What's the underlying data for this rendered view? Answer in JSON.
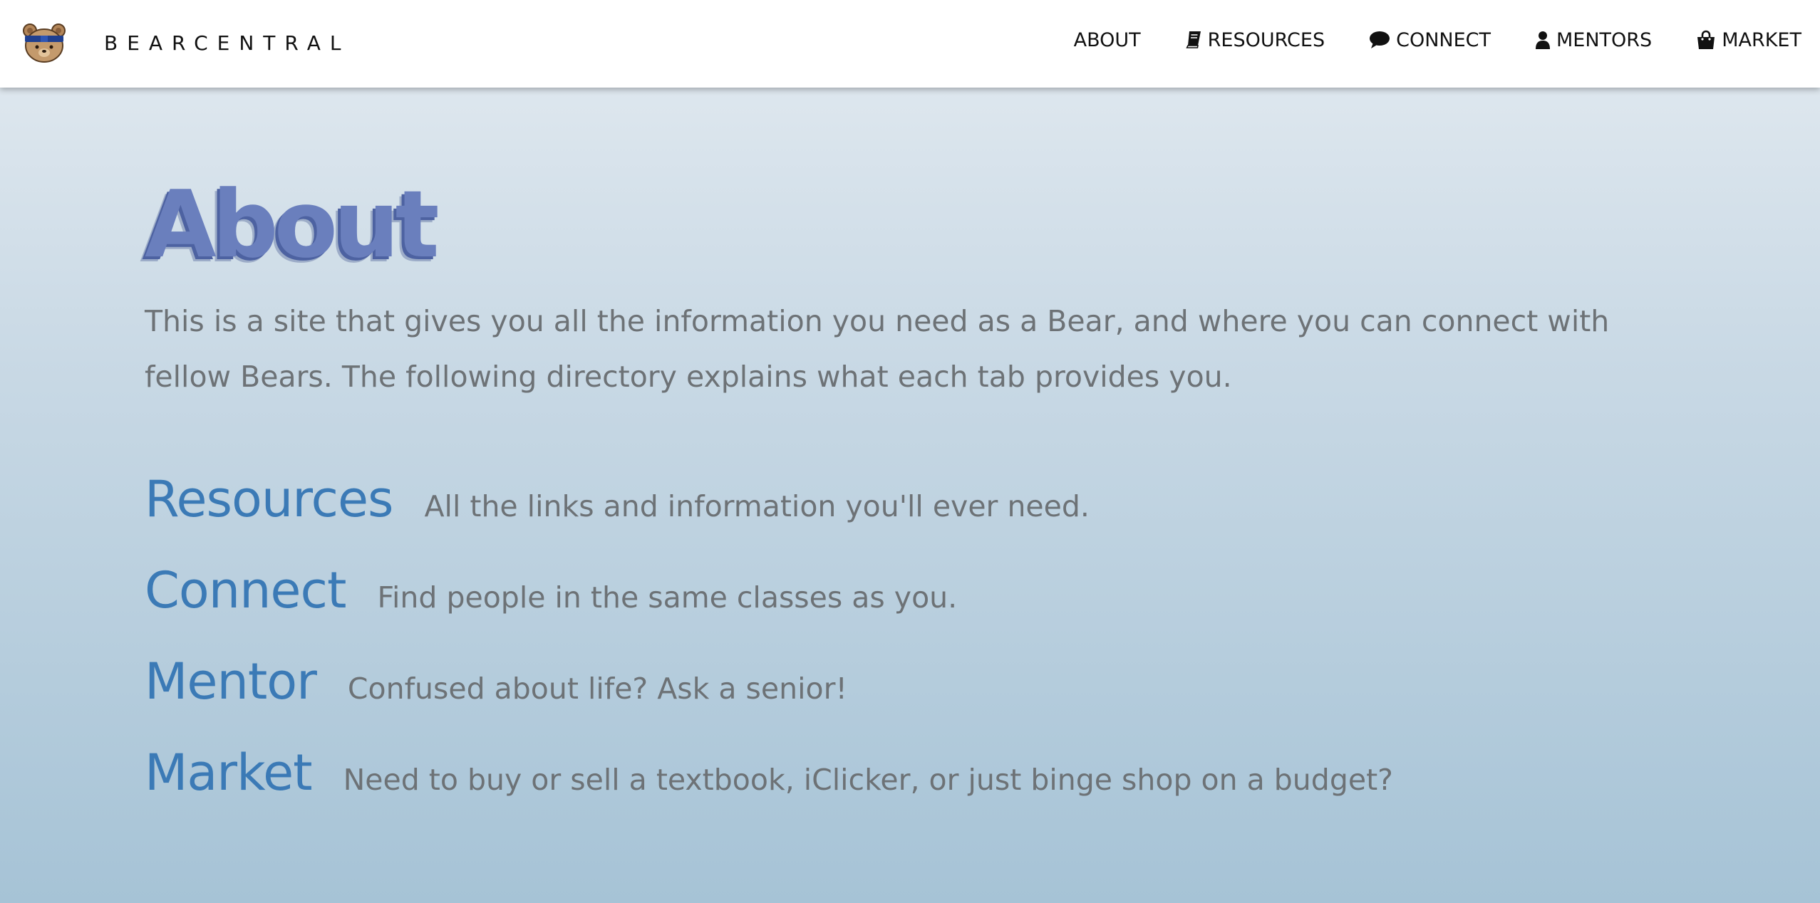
{
  "navbar": {
    "brand": {
      "name": "BEARCENTRAL",
      "logo_icon": "bear-logo-icon"
    },
    "items": [
      {
        "label": "ABOUT",
        "icon": ""
      },
      {
        "label": "RESOURCES",
        "icon": "book-icon"
      },
      {
        "label": "CONNECT",
        "icon": "speech-bubble-icon"
      },
      {
        "label": "MENTORS",
        "icon": "user-icon"
      },
      {
        "label": "MARKET",
        "icon": "shopping-bag-icon"
      }
    ]
  },
  "about": {
    "title": "About",
    "intro": "This is a site that gives you all the information you need as a Bear, and where you can connect with fellow Bears. The following directory explains what each tab provides you."
  },
  "directory": [
    {
      "name": "Resources",
      "description": "All the links and information you'll ever need."
    },
    {
      "name": "Connect",
      "description": "Find people in the same classes as you."
    },
    {
      "name": "Mentor",
      "description": "Confused about life? Ask a senior!"
    },
    {
      "name": "Market",
      "description": "Need to buy or sell a textbook, iClicker, or just binge shop on a budget?"
    }
  ],
  "colors": {
    "title": "#6a7fbd",
    "title_shadow": "#4d62a1",
    "link": "#3b7ab6",
    "body_text": "#6d7276",
    "nav_text": "#111111",
    "background_top": "#e4ebf1",
    "background_bottom": "#a6c3d6"
  }
}
